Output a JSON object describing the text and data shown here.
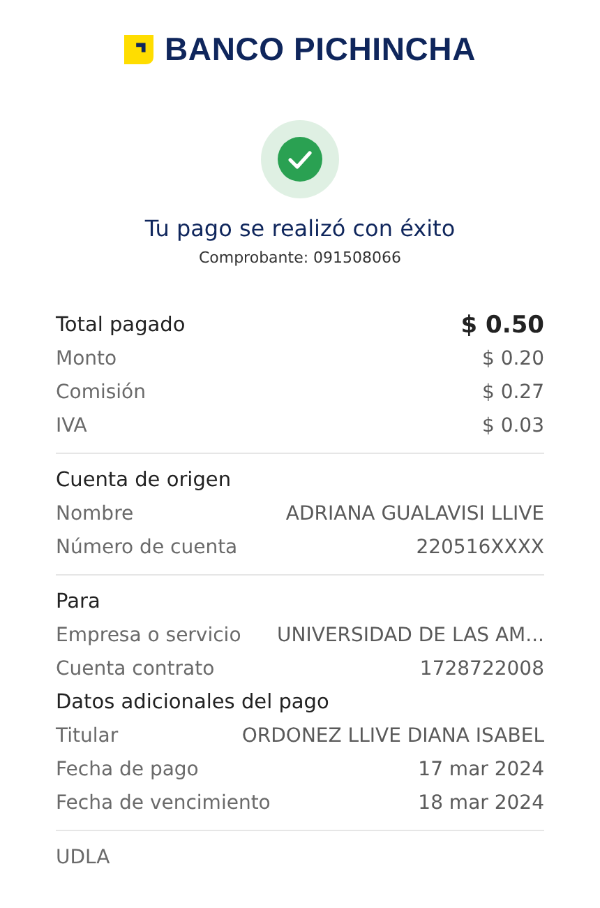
{
  "brand": {
    "name": "BANCO PICHINCHA"
  },
  "status": {
    "title": "Tu pago se realizó con éxito",
    "receipt": "Comprobante: 091508066"
  },
  "groups": [
    {
      "items": [
        {
          "kind": "total",
          "label": "Total pagado",
          "value": "$ 0.50"
        },
        {
          "kind": "row",
          "label": "Monto",
          "value": "$ 0.20"
        },
        {
          "kind": "row",
          "label": "Comisión",
          "value": "$ 0.27"
        },
        {
          "kind": "row",
          "label": "IVA",
          "value": "$ 0.03"
        }
      ]
    },
    {
      "items": [
        {
          "kind": "heading",
          "label": "Cuenta de origen"
        },
        {
          "kind": "row",
          "label": "Nombre",
          "value": "ADRIANA GUALAVISI LLIVE"
        },
        {
          "kind": "row",
          "label": "Número de cuenta",
          "value": "220516XXXX"
        }
      ]
    },
    {
      "items": [
        {
          "kind": "heading",
          "label": "Para"
        },
        {
          "kind": "row",
          "label": "Empresa o servicio",
          "value": "UNIVERSIDAD DE LAS AM..."
        },
        {
          "kind": "row",
          "label": "Cuenta contrato",
          "value": "1728722008"
        },
        {
          "kind": "heading",
          "label": "Datos adicionales del pago"
        },
        {
          "kind": "row",
          "label": "Titular",
          "value": "ORDONEZ LLIVE DIANA ISABEL"
        },
        {
          "kind": "row",
          "label": "Fecha de pago",
          "value": "17 mar 2024"
        },
        {
          "kind": "row",
          "label": "Fecha de vencimiento",
          "value": "18 mar 2024"
        }
      ]
    },
    {
      "items": [
        {
          "kind": "note",
          "label": "UDLA"
        }
      ]
    }
  ]
}
